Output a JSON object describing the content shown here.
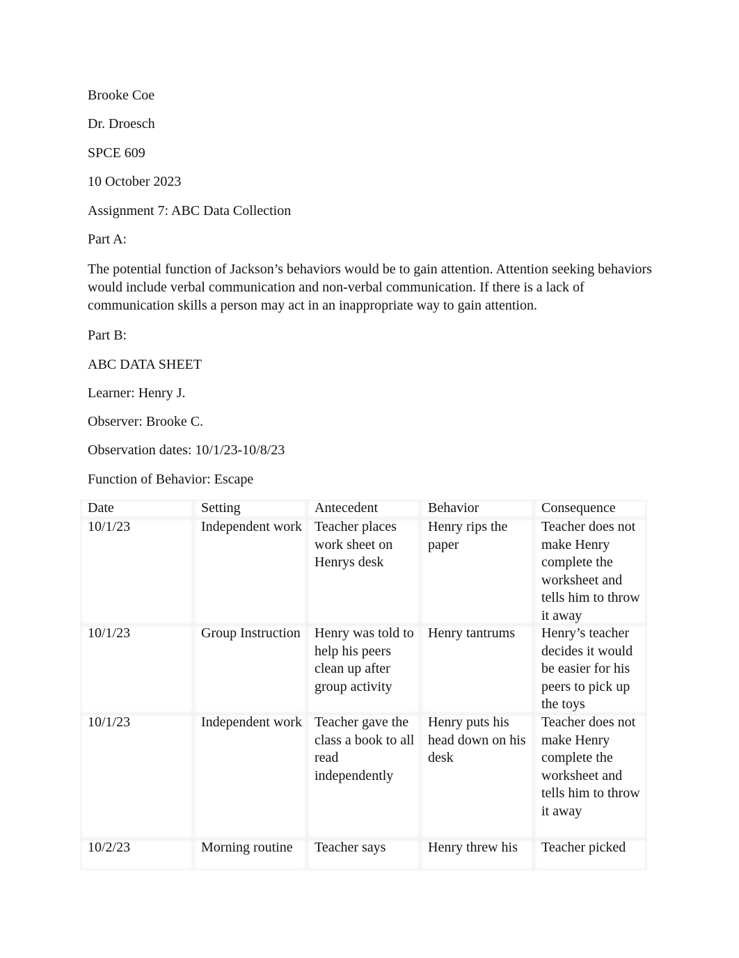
{
  "header": {
    "author": "Brooke Coe",
    "instructor": "Dr. Droesch",
    "course": "SPCE 609",
    "date": "10 October 2023",
    "title": "Assignment 7: ABC Data Collection"
  },
  "part_a": {
    "heading": "Part A:",
    "text": "The potential function of Jackson’s behaviors would be to gain attention. Attention seeking behaviors would include verbal communication and non-verbal communication. If there is a lack of communication skills a person may act in an inappropriate way to gain attention."
  },
  "part_b": {
    "heading": "Part B:",
    "sheet_title": "ABC DATA SHEET",
    "learner": "Learner: Henry J.",
    "observer": "Observer: Brooke C.",
    "dates": "Observation dates: 10/1/23-10/8/23",
    "function": "Function of Behavior: Escape"
  },
  "table": {
    "headers": [
      "Date",
      "Setting",
      "Antecedent",
      "Behavior",
      "Consequence"
    ],
    "rows": [
      [
        "10/1/23",
        "Independent work",
        "Teacher places work sheet on Henrys desk",
        "Henry rips the paper",
        "Teacher does not make Henry complete the worksheet and tells him to throw it away"
      ],
      [
        "10/1/23",
        "Group Instruction",
        "Henry was told to help his peers clean up after group activity",
        "Henry tantrums",
        "Henry’s teacher decides it would be easier for his peers to pick up the toys"
      ],
      [
        "10/1/23",
        "Independent work",
        "Teacher gave the class a book to all read independently",
        "Henry puts his head down on his desk",
        "Teacher does not make Henry complete the worksheet and tells him to throw it away"
      ],
      [
        "10/2/23",
        "Morning routine",
        "Teacher says",
        "Henry threw his",
        "Teacher picked"
      ]
    ]
  }
}
